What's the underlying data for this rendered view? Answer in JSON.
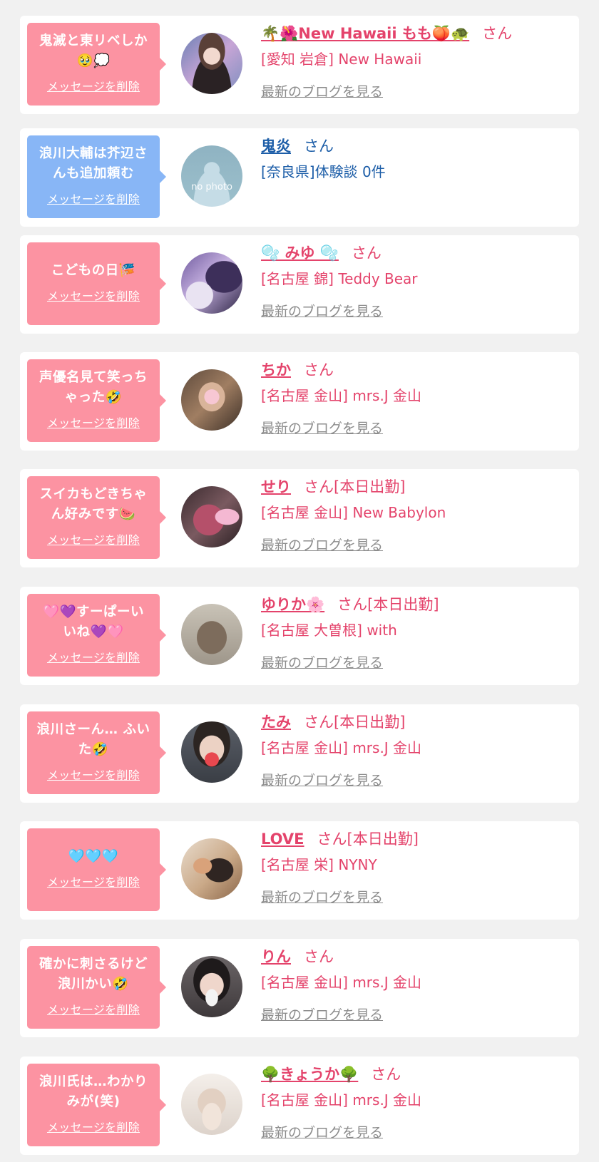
{
  "colors": {
    "page_background": "#f1f1f1",
    "card_background": "#ffffff",
    "bubble_pink": "#fc93a2",
    "bubble_blue": "#88b6f6",
    "name_pink": "#e4436b",
    "name_blue": "#1d5ea8",
    "blog_gray": "#8c8c8c"
  },
  "entries": [
    {
      "message": "鬼滅と東リベしか\n🥹💭",
      "delete_label": "メッセージを削除",
      "name": "🌴🌺New Hawaii もも🍑🐢",
      "honorific": "さん",
      "status": "",
      "shop": "[愛知 岩倉] New Hawaii",
      "blog_label": "最新のブログを見る",
      "theme": "pink",
      "avatar": "photo-avatar"
    },
    {
      "message": "浪川大輔は芥辺さ\nんも追加頼む",
      "delete_label": "メッセージを削除",
      "name": "鬼炎",
      "honorific": "さん",
      "status": "",
      "shop": "[奈良県]体験談 0件",
      "blog_label": "",
      "theme": "blue",
      "avatar": "no-photo-avatar",
      "avatar_text": "no photo"
    },
    {
      "message": "こどもの日🎏",
      "delete_label": "メッセージを削除",
      "name": "🫧 みゆ 🫧",
      "honorific": "さん",
      "status": "",
      "shop": "[名古屋 錦] Teddy Bear",
      "blog_label": "最新のブログを見る",
      "theme": "pink",
      "avatar": "photo-avatar"
    },
    {
      "message": "声優名見て笑っち\nゃった🤣",
      "delete_label": "メッセージを削除",
      "name": "ちか",
      "honorific": "さん",
      "status": "",
      "shop": "[名古屋 金山] mrs.J 金山",
      "blog_label": "最新のブログを見る",
      "theme": "pink",
      "avatar": "photo-avatar"
    },
    {
      "message": "スイカもどきちゃ\nん好みです🍉",
      "delete_label": "メッセージを削除",
      "name": "せり",
      "honorific": "さん",
      "status": "[本日出勤]",
      "shop": "[名古屋 金山] New Babylon",
      "blog_label": "最新のブログを見る",
      "theme": "pink",
      "avatar": "photo-avatar"
    },
    {
      "message": "🩷💜すーぱーい\nいね💜🩷",
      "delete_label": "メッセージを削除",
      "name": "ゆりか🌸",
      "honorific": "さん",
      "status": "[本日出勤]",
      "shop": "[名古屋 大曽根] with",
      "blog_label": "最新のブログを見る",
      "theme": "pink",
      "avatar": "photo-avatar"
    },
    {
      "message": "浪川さーん… ふい\nた🤣",
      "delete_label": "メッセージを削除",
      "name": "たみ",
      "honorific": "さん",
      "status": "[本日出勤]",
      "shop": "[名古屋 金山] mrs.J 金山",
      "blog_label": "最新のブログを見る",
      "theme": "pink",
      "avatar": "photo-avatar"
    },
    {
      "message": "🩵🩵🩵",
      "delete_label": "メッセージを削除",
      "name": "LOVE",
      "honorific": "さん",
      "status": "[本日出勤]",
      "shop": "[名古屋 栄] NYNY",
      "blog_label": "最新のブログを見る",
      "theme": "pink",
      "avatar": "photo-avatar"
    },
    {
      "message": "確かに刺さるけど\n浪川かい🤣",
      "delete_label": "メッセージを削除",
      "name": "りん",
      "honorific": "さん",
      "status": "",
      "shop": "[名古屋 金山] mrs.J 金山",
      "blog_label": "最新のブログを見る",
      "theme": "pink",
      "avatar": "photo-avatar"
    },
    {
      "message": "浪川氏は…わかり\nみが(笑)",
      "delete_label": "メッセージを削除",
      "name": "🌳きょうか🌳",
      "honorific": "さん",
      "status": "",
      "shop": "[名古屋 金山] mrs.J 金山",
      "blog_label": "最新のブログを見る",
      "theme": "pink",
      "avatar": "photo-avatar"
    }
  ]
}
